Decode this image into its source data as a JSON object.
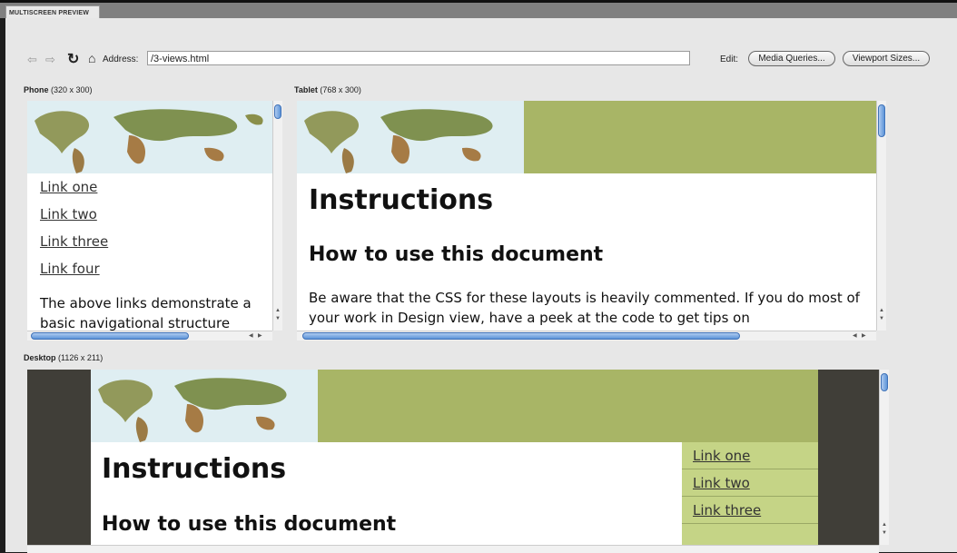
{
  "window": {
    "tab_title": "MULTISCREEN PREVIEW"
  },
  "toolbar": {
    "back_icon": "back-arrow-icon",
    "forward_icon": "forward-arrow-icon",
    "refresh_icon": "refresh-icon",
    "home_icon": "home-icon",
    "address_label": "Address:",
    "address_value": "/3-views.html",
    "edit_label": "Edit:",
    "media_queries_label": "Media Queries...",
    "viewport_sizes_label": "Viewport Sizes..."
  },
  "viewports": {
    "phone": {
      "name": "Phone",
      "size": "(320 x 300)"
    },
    "tablet": {
      "name": "Tablet",
      "size": "(768 x 300)"
    },
    "desktop": {
      "name": "Desktop",
      "size": "(1126 x 211)"
    }
  },
  "content": {
    "links": [
      "Link one",
      "Link two",
      "Link three",
      "Link four"
    ],
    "heading": "Instructions",
    "subheading": "How to use this document",
    "phone_paragraph": "The above links demonstrate a basic navigational structure",
    "tablet_paragraph": "Be aware that the CSS for these layouts is heavily commented. If you do most of your work in Design view, have a peek at the code to get tips on"
  },
  "colors": {
    "header_green": "#a8b566",
    "nav_green": "#c5d486",
    "desktop_side": "#403e38",
    "scroll_blue": "#5d94d8"
  }
}
